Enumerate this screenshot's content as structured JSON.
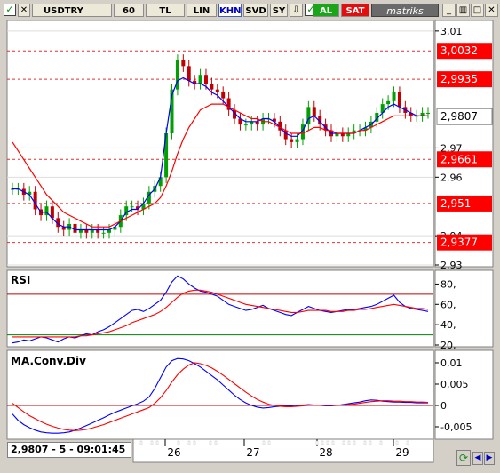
{
  "toolbar": {
    "symbol": "USDTRY",
    "period": "60",
    "currency": "TL",
    "scale": "LIN",
    "khn": "KHN",
    "svd": "SVD",
    "sy": "SY",
    "al": "AL",
    "sat": "SAT",
    "brand": "matriks"
  },
  "status": {
    "readout": "2,9807 - 5 - 09:01:45"
  },
  "colors": {
    "price_fast_ma": "#0000ff",
    "price_slow_ma": "#ff0000",
    "up_candle": "#00a000",
    "down_candle": "#c00000",
    "level_line": "#e03030",
    "label_bg": "#ff0000",
    "current_label_bg": "#ffffff",
    "rsi_line": "#0000ff",
    "rsi_signal": "#ff0000",
    "macd_line": "#0000ff",
    "macd_signal": "#ff0000"
  },
  "chart_data": [
    {
      "type": "line",
      "title": "",
      "ylim": [
        2.93,
        3.013
      ],
      "y_ticks": [
        {
          "value": 3.01,
          "label": "3,01"
        },
        {
          "value": 2.97,
          "label": "2,97"
        },
        {
          "value": 2.96,
          "label": "2,96"
        },
        {
          "value": 2.94,
          "label": "2,94"
        },
        {
          "value": 2.93,
          "label": "2,93"
        }
      ],
      "x_ticks": [
        "26",
        "27",
        "28",
        "29"
      ],
      "price_levels": [
        {
          "value": 3.0032,
          "label": "3,0032"
        },
        {
          "value": 2.9935,
          "label": "2,9935"
        },
        {
          "value": 2.9661,
          "label": "2,9661"
        },
        {
          "value": 2.951,
          "label": "2,951"
        },
        {
          "value": 2.9377,
          "label": "2,9377"
        }
      ],
      "current_price": {
        "value": 2.9807,
        "label": "2,9807"
      },
      "candles_close": [
        2.956,
        2.956,
        2.954,
        2.955,
        2.949,
        2.947,
        2.95,
        2.946,
        2.943,
        2.942,
        2.944,
        2.941,
        2.942,
        2.941,
        2.942,
        2.941,
        2.941,
        2.942,
        2.943,
        2.947,
        2.95,
        2.95,
        2.949,
        2.951,
        2.955,
        2.957,
        2.96,
        2.975,
        2.99,
        3.0,
        2.998,
        2.993,
        2.992,
        2.995,
        2.992,
        2.99,
        2.989,
        2.987,
        2.983,
        2.98,
        2.978,
        2.978,
        2.979,
        2.978,
        2.98,
        2.98,
        2.979,
        2.976,
        2.973,
        2.972,
        2.973,
        2.978,
        2.984,
        2.981,
        2.978,
        2.976,
        2.974,
        2.975,
        2.974,
        2.975,
        2.976,
        2.976,
        2.977,
        2.979,
        2.982,
        2.985,
        2.986,
        2.989,
        2.984,
        2.982,
        2.981,
        2.981,
        2.982,
        2.982
      ],
      "series": [
        {
          "name": "",
          "values": [
            2.956,
            2.956,
            2.955,
            2.954,
            2.951,
            2.948,
            2.948,
            2.946,
            2.944,
            2.943,
            2.943,
            2.942,
            2.942,
            2.942,
            2.942,
            2.942,
            2.942,
            2.942,
            2.943,
            2.945,
            2.948,
            2.949,
            2.949,
            2.951,
            2.954,
            2.956,
            2.96,
            2.975,
            2.988,
            2.993,
            2.994,
            2.993,
            2.992,
            2.992,
            2.991,
            2.989,
            2.988,
            2.986,
            2.984,
            2.982,
            2.98,
            2.979,
            2.979,
            2.979,
            2.98,
            2.98,
            2.979,
            2.977,
            2.975,
            2.974,
            2.974,
            2.976,
            2.98,
            2.981,
            2.979,
            2.977,
            2.975,
            2.975,
            2.975,
            2.975,
            2.975,
            2.976,
            2.977,
            2.978,
            2.98,
            2.982,
            2.984,
            2.985,
            2.984,
            2.983,
            2.982,
            2.981,
            2.981,
            2.981
          ]
        },
        {
          "name": "",
          "values": [
            2.972,
            2.969,
            2.966,
            2.963,
            2.96,
            2.957,
            2.954,
            2.952,
            2.95,
            2.948,
            2.947,
            2.946,
            2.945,
            2.944,
            2.943,
            2.943,
            2.943,
            2.943,
            2.944,
            2.945,
            2.946,
            2.947,
            2.948,
            2.949,
            2.95,
            2.951,
            2.953,
            2.957,
            2.962,
            2.968,
            2.973,
            2.977,
            2.98,
            2.983,
            2.984,
            2.985,
            2.985,
            2.985,
            2.984,
            2.983,
            2.982,
            2.981,
            2.98,
            2.98,
            2.979,
            2.979,
            2.978,
            2.977,
            2.976,
            2.975,
            2.975,
            2.975,
            2.976,
            2.977,
            2.977,
            2.976,
            2.976,
            2.975,
            2.975,
            2.975,
            2.975,
            2.976,
            2.976,
            2.977,
            2.978,
            2.979,
            2.98,
            2.981,
            2.981,
            2.981,
            2.981,
            2.981,
            2.981,
            2.981
          ]
        }
      ]
    },
    {
      "type": "line",
      "title": "RSI",
      "ylim": [
        20,
        90
      ],
      "y_ticks": [
        {
          "value": 80,
          "label": "80,"
        },
        {
          "value": 60,
          "label": "60,"
        },
        {
          "value": 40,
          "label": "40,"
        },
        {
          "value": 20,
          "label": "20,"
        }
      ],
      "reference_lines": [
        70,
        30
      ],
      "series": [
        {
          "name": "",
          "values": [
            22,
            23,
            25,
            24,
            26,
            28,
            27,
            25,
            23,
            26,
            28,
            27,
            29,
            31,
            30,
            33,
            35,
            38,
            42,
            46,
            50,
            54,
            55,
            53,
            56,
            60,
            64,
            72,
            82,
            88,
            85,
            80,
            76,
            73,
            72,
            70,
            68,
            64,
            60,
            58,
            56,
            54,
            55,
            57,
            59,
            56,
            54,
            52,
            50,
            49,
            52,
            55,
            58,
            56,
            54,
            53,
            52,
            53,
            54,
            55,
            55,
            56,
            57,
            58,
            60,
            63,
            66,
            69,
            62,
            58,
            56,
            55,
            54,
            53
          ]
        },
        {
          "name": "",
          "values": [
            28,
            28,
            28,
            28,
            28,
            28,
            28,
            28,
            28,
            28,
            28,
            28,
            29,
            29,
            30,
            31,
            32,
            33,
            35,
            37,
            39,
            42,
            44,
            46,
            48,
            50,
            53,
            57,
            62,
            67,
            71,
            73,
            74,
            74,
            73,
            72,
            70,
            68,
            66,
            64,
            62,
            60,
            59,
            58,
            57,
            56,
            55,
            54,
            53,
            52,
            52,
            53,
            54,
            54,
            54,
            54,
            53,
            53,
            53,
            54,
            54,
            55,
            55,
            56,
            57,
            58,
            59,
            60,
            59,
            58,
            57,
            56,
            56,
            55
          ]
        }
      ]
    },
    {
      "type": "line",
      "title": "MA.Conv.Div",
      "ylim": [
        -0.0075,
        0.0125
      ],
      "y_ticks": [
        {
          "value": 0.01,
          "label": "0,01"
        },
        {
          "value": 0.005,
          "label": "0,005"
        },
        {
          "value": 0,
          "label": "0"
        },
        {
          "value": -0.005,
          "label": "-0,005"
        }
      ],
      "reference_lines": [
        0
      ],
      "series": [
        {
          "name": "",
          "values": [
            -0.002,
            -0.0035,
            -0.0045,
            -0.0052,
            -0.0058,
            -0.0062,
            -0.0064,
            -0.0065,
            -0.0065,
            -0.0064,
            -0.0062,
            -0.0058,
            -0.0053,
            -0.0047,
            -0.0041,
            -0.0035,
            -0.0029,
            -0.0022,
            -0.0016,
            -0.0011,
            -0.0006,
            -0.0001,
            0.0004,
            0.001,
            0.002,
            0.004,
            0.0065,
            0.009,
            0.0105,
            0.011,
            0.0109,
            0.0105,
            0.0098,
            0.009,
            0.008,
            0.007,
            0.006,
            0.0048,
            0.0036,
            0.0024,
            0.0014,
            0.0006,
            0.0,
            -0.0004,
            -0.0006,
            -0.0005,
            -0.0003,
            -0.0002,
            -0.0002,
            -0.0001,
            0.0,
            0.0001,
            0.0002,
            0.0001,
            0.0,
            -0.0001,
            -0.0001,
            0.0,
            0.0002,
            0.0004,
            0.0006,
            0.0008,
            0.0011,
            0.0013,
            0.0012,
            0.001,
            0.0009,
            0.0008,
            0.0008,
            0.0007,
            0.0007,
            0.0006,
            0.0006,
            0.0006
          ]
        },
        {
          "name": "",
          "values": [
            0.0005,
            -0.0005,
            -0.0015,
            -0.0024,
            -0.0031,
            -0.0038,
            -0.0044,
            -0.0049,
            -0.0053,
            -0.0056,
            -0.0058,
            -0.0059,
            -0.0058,
            -0.0056,
            -0.0053,
            -0.0049,
            -0.0045,
            -0.004,
            -0.0035,
            -0.003,
            -0.0025,
            -0.002,
            -0.0015,
            -0.001,
            -0.0005,
            0.0005,
            0.0018,
            0.0035,
            0.0055,
            0.0072,
            0.0085,
            0.0095,
            0.01,
            0.0098,
            0.0094,
            0.0088,
            0.008,
            0.0071,
            0.0061,
            0.0051,
            0.0041,
            0.0031,
            0.0022,
            0.0014,
            0.0008,
            0.0003,
            0.0,
            -0.0002,
            -0.0003,
            -0.0003,
            -0.0002,
            -0.0001,
            0.0,
            0.0,
            0.0,
            0.0,
            0.0,
            0.0,
            0.0001,
            0.0002,
            0.0003,
            0.0005,
            0.0007,
            0.0009,
            0.001,
            0.0011,
            0.0011,
            0.001,
            0.001,
            0.0009,
            0.0009,
            0.0008,
            0.0008,
            0.0007
          ]
        }
      ]
    }
  ]
}
